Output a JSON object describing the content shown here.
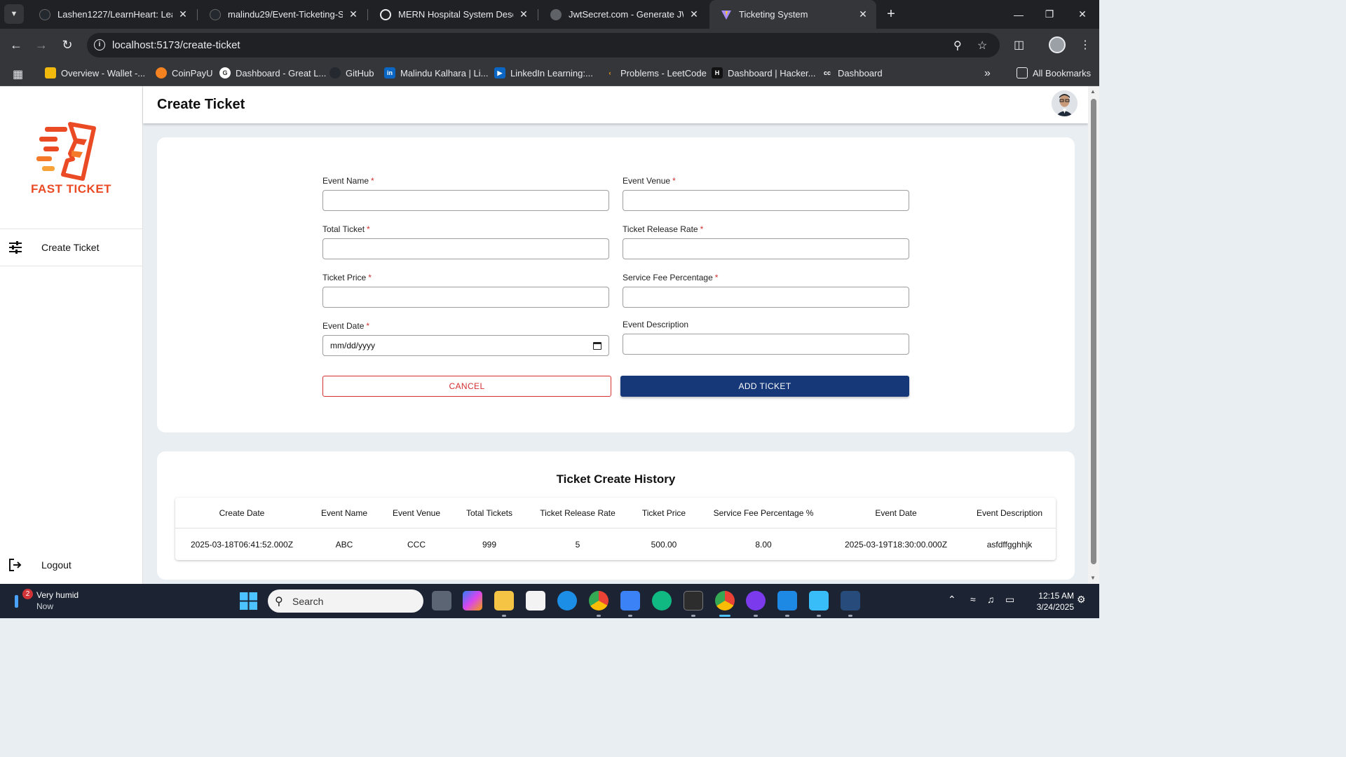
{
  "browser": {
    "tabs": [
      {
        "title": "Lashen1227/LearnHeart: LearnH",
        "icon": "github-icon"
      },
      {
        "title": "malindu29/Event-Ticketing-Syst",
        "icon": "github-icon"
      },
      {
        "title": "MERN Hospital System Descript",
        "icon": "chatgpt-icon"
      },
      {
        "title": "JwtSecret.com - Generate JWT S",
        "icon": "globe-icon"
      },
      {
        "title": "Ticketing System",
        "icon": "vite-icon",
        "active": true
      }
    ],
    "url": "localhost:5173/create-ticket",
    "bookmarks": [
      {
        "label": "Overview - Wallet -..."
      },
      {
        "label": "CoinPayU"
      },
      {
        "label": "Dashboard - Great L..."
      },
      {
        "label": "GitHub"
      },
      {
        "label": "Malindu Kalhara | Li..."
      },
      {
        "label": "LinkedIn Learning:..."
      },
      {
        "label": "Problems - LeetCode"
      },
      {
        "label": "Dashboard | Hacker..."
      },
      {
        "label": "Dashboard"
      }
    ],
    "all_bookmarks": "All Bookmarks"
  },
  "sidebar": {
    "logo_text": "FAST TICKET",
    "items": [
      {
        "label": "Create Ticket",
        "icon": "sliders-icon"
      }
    ],
    "logout": "Logout"
  },
  "header": {
    "title": "Create Ticket"
  },
  "form": {
    "fields": [
      {
        "label": "Event Name",
        "required": true,
        "value": ""
      },
      {
        "label": "Event Venue",
        "required": true,
        "value": ""
      },
      {
        "label": "Total Ticket",
        "required": true,
        "value": ""
      },
      {
        "label": "Ticket Release Rate",
        "required": true,
        "value": ""
      },
      {
        "label": "Ticket Price",
        "required": true,
        "value": ""
      },
      {
        "label": "Service Fee Percentage",
        "required": true,
        "value": ""
      },
      {
        "label": "Event Date",
        "required": true,
        "value": "mm/dd/yyyy"
      },
      {
        "label": "Event Description",
        "required": false,
        "value": ""
      }
    ],
    "required_mark": "*",
    "cancel_label": "CANCEL",
    "add_label": "ADD TICKET"
  },
  "history": {
    "title": "Ticket Create History",
    "columns": [
      "Create Date",
      "Event Name",
      "Event Venue",
      "Total Tickets",
      "Ticket Release Rate",
      "Ticket Price",
      "Service Fee Percentage %",
      "Event Date",
      "Event Description"
    ],
    "rows": [
      [
        "2025-03-18T06:41:52.000Z",
        "ABC",
        "CCC",
        "999",
        "5",
        "500.00",
        "8.00",
        "2025-03-19T18:30:00.000Z",
        "asfdffgghhjk"
      ]
    ]
  },
  "taskbar": {
    "weather_badge": "2",
    "weather_text": "Very humid",
    "weather_sub": "Now",
    "search_placeholder": "Search",
    "time": "12:15 AM",
    "date": "3/24/2025"
  },
  "colors": {
    "primary": "#163879",
    "danger": "#d32f2f",
    "brand": "#ea4a24"
  }
}
